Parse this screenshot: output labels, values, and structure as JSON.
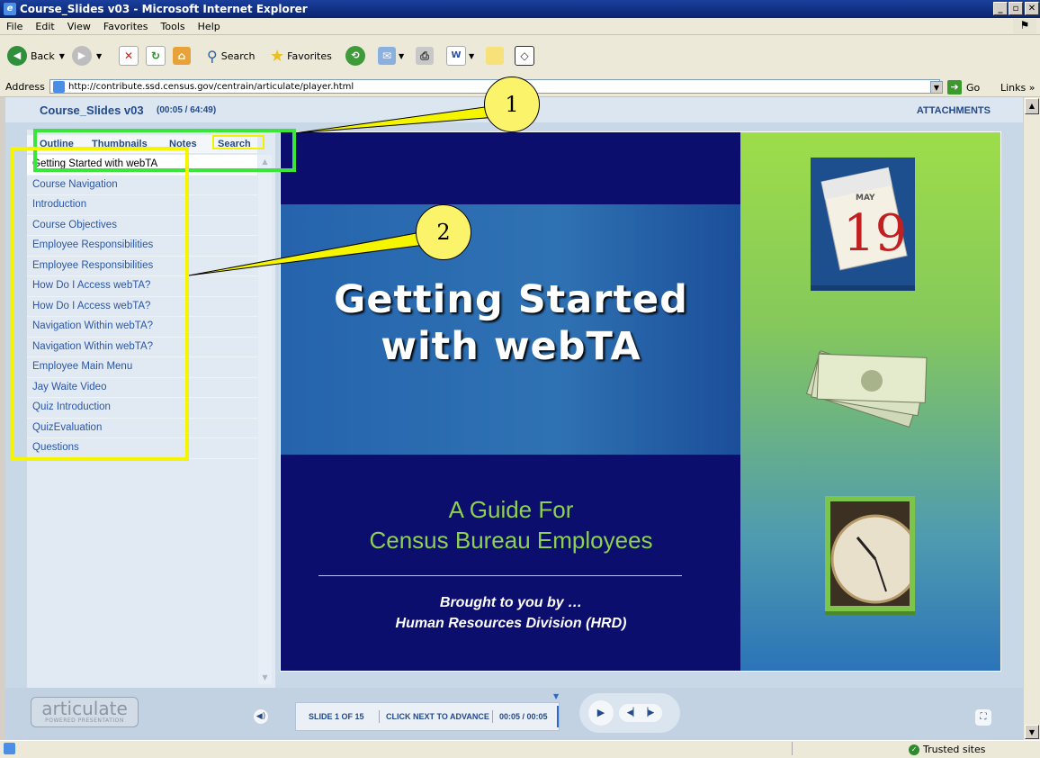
{
  "window": {
    "title": "Course_Slides v03 - Microsoft Internet Explorer"
  },
  "menu": [
    "File",
    "Edit",
    "View",
    "Favorites",
    "Tools",
    "Help"
  ],
  "toolbar": {
    "back": "Back",
    "search": "Search",
    "favorites": "Favorites"
  },
  "address": {
    "label": "Address",
    "url": "http://contribute.ssd.census.gov/centrain/articulate/player.html",
    "go": "Go",
    "links": "Links"
  },
  "player": {
    "course_title": "Course_Slides v03",
    "course_time": "(00:05 / 64:49)",
    "attachments": "ATTACHMENTS",
    "tabs": [
      "Outline",
      "Thumbnails",
      "Notes",
      "Search"
    ],
    "outline": [
      "Getting Started with webTA",
      "Course Navigation",
      "Introduction",
      "Course Objectives",
      "Employee Responsibilities",
      "Employee Responsibilities",
      "How Do I Access webTA?",
      "How Do I Access webTA?",
      "Navigation Within webTA?",
      "Navigation Within webTA?",
      "Employee Main Menu",
      "Jay Waite Video",
      "Quiz Introduction",
      "QuizEvaluation",
      "Questions"
    ],
    "slide": {
      "title_line1": "Getting Started",
      "title_line2": "with webTA",
      "subtitle_line1": "A Guide For",
      "subtitle_line2": "Census Bureau Employees",
      "credit_line1": "Brought to you by …",
      "credit_line2": "Human Resources Division (HRD)",
      "calendar_month": "MAY",
      "calendar_day": "19"
    },
    "controls": {
      "logo_text": "articulate",
      "logo_sub": "POWERED PRESENTATION",
      "slide_counter": "SLIDE 1 OF 15",
      "hint": "CLICK NEXT TO ADVANCE",
      "time": "00:05 / 00:05"
    }
  },
  "status": {
    "zone": "Trusted sites"
  },
  "annotations": {
    "callout1": "1",
    "callout2": "2"
  },
  "colors": {
    "green_box": "#39e639",
    "yellow_box": "#f5f500",
    "callout_fill": "#fbf36a",
    "accent": "#244a8a"
  }
}
